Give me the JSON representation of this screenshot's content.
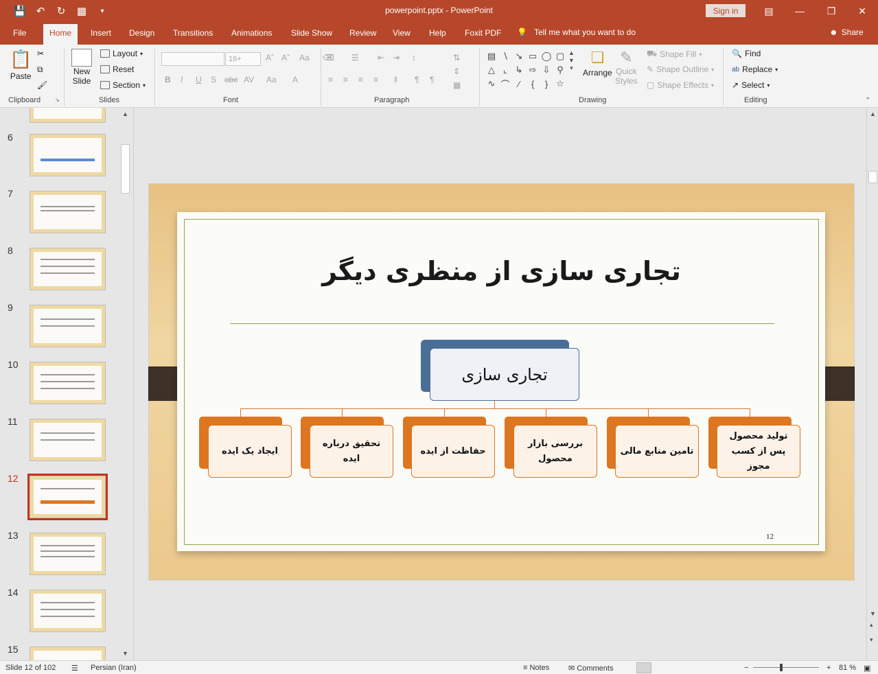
{
  "window": {
    "title": "powerpoint.pptx",
    "separator": "-",
    "app_name": "PowerPoint",
    "sign_in": "Sign in"
  },
  "quick_access": {
    "save_icon": "save-icon",
    "undo_icon": "undo-icon",
    "redo_icon": "redo-icon",
    "present_icon": "present-icon",
    "customize_icon": "chevron-down-icon"
  },
  "tabs": [
    "File",
    "Home",
    "Insert",
    "Design",
    "Transitions",
    "Animations",
    "Slide Show",
    "Review",
    "View",
    "Help",
    "Foxit PDF"
  ],
  "active_tab": "Home",
  "tell_me": "Tell me what you want to do",
  "share": "Share",
  "ribbon": {
    "clipboard": {
      "label": "Clipboard",
      "paste": "Paste"
    },
    "slides": {
      "label": "Slides",
      "new_slide": "New",
      "new_slide_2": "Slide",
      "layout": "Layout",
      "reset": "Reset",
      "section": "Section"
    },
    "font": {
      "label": "Font",
      "size": "16+"
    },
    "paragraph": {
      "label": "Paragraph"
    },
    "drawing": {
      "label": "Drawing",
      "arrange": "Arrange",
      "quick_styles": "Quick",
      "quick_styles_2": "Styles",
      "shape_fill": "Shape Fill",
      "shape_outline": "Shape Outline",
      "shape_effects": "Shape Effects"
    },
    "editing": {
      "label": "Editing",
      "find": "Find",
      "replace": "Replace",
      "select": "Select"
    }
  },
  "thumbnails": [
    {
      "num": "6"
    },
    {
      "num": "7"
    },
    {
      "num": "8"
    },
    {
      "num": "9"
    },
    {
      "num": "10"
    },
    {
      "num": "11"
    },
    {
      "num": "12"
    },
    {
      "num": "13"
    },
    {
      "num": "14"
    },
    {
      "num": "15"
    }
  ],
  "selected_slide": "12",
  "slide": {
    "title": "تجاری سازی از منظری دیگر",
    "root": "تجاری سازی",
    "children": [
      "ایجاد یک ایده",
      "تحقیق درباره ایده",
      "حفاظت از ایده",
      "بررسی بازار محصول",
      "تامین منابع مالی",
      "تولید محصول پس از کسب مجوز"
    ],
    "page_number": "12"
  },
  "status": {
    "slide_info": "Slide 12 of 102",
    "language": "Persian (Iran)",
    "notes": "Notes",
    "comments": "Comments",
    "zoom_minus": "−",
    "zoom_plus": "+",
    "zoom": "81 %"
  },
  "colors": {
    "accent": "#b7472a",
    "root_box": "#4a6f97",
    "child_box": "#dd7620",
    "selection": "#c4331c"
  }
}
